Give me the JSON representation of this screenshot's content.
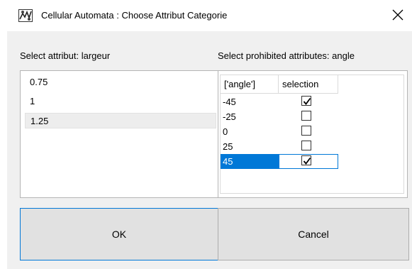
{
  "window": {
    "title": "Cellular Automata : Choose Attribut Categorie",
    "close_symbol": "✕",
    "app_icon": "cellular-automata-app-icon"
  },
  "left_panel": {
    "label": "Select attribut: largeur",
    "items": [
      {
        "label": "0.75",
        "selected": false
      },
      {
        "label": "1",
        "selected": false
      },
      {
        "label": "1.25",
        "selected": true
      }
    ]
  },
  "right_panel": {
    "label": "Select prohibited attributes: angle",
    "columns": [
      "['angle']",
      "selection"
    ],
    "rows": [
      {
        "value": "-45",
        "checked": true,
        "selected": false
      },
      {
        "value": "-25",
        "checked": false,
        "selected": false
      },
      {
        "value": "0",
        "checked": false,
        "selected": false
      },
      {
        "value": "25",
        "checked": false,
        "selected": false
      },
      {
        "value": "45",
        "checked": true,
        "selected": true
      }
    ]
  },
  "buttons": {
    "ok": "OK",
    "cancel": "Cancel"
  },
  "colors": {
    "selection_blue": "#0078d7",
    "dialog_bg": "#f0f0f0",
    "button_bg": "#e1e1e1"
  }
}
